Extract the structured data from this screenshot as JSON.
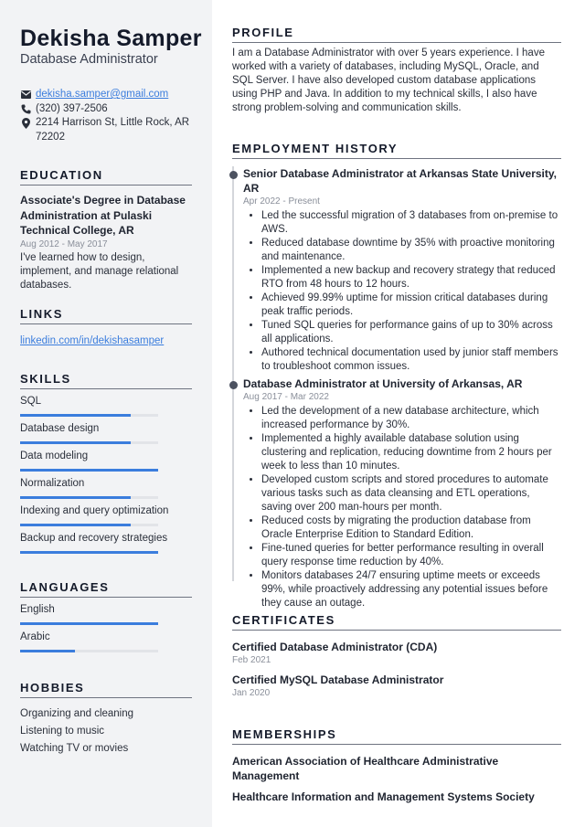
{
  "header": {
    "name": "Dekisha Samper",
    "title": "Database Administrator"
  },
  "contact": {
    "email": "dekisha.samper@gmail.com",
    "phone": "(320) 397-2506",
    "address": "2214 Harrison St, Little Rock, AR 72202",
    "icons": [
      "envelope-icon",
      "phone-icon",
      "map-pin-icon"
    ]
  },
  "education": {
    "heading": "EDUCATION",
    "degree": "Associate's Degree in Database Administration at Pulaski Technical College, AR",
    "dates": "Aug 2012 - May 2017",
    "description": "I've learned how to design, implement, and manage relational databases."
  },
  "links": {
    "heading": "LINKS",
    "items": [
      "linkedin.com/in/dekishasamper"
    ]
  },
  "skills": {
    "heading": "SKILLS",
    "items": [
      {
        "label": "SQL",
        "level": 0.8
      },
      {
        "label": "Database design",
        "level": 0.8
      },
      {
        "label": "Data modeling",
        "level": 1.0
      },
      {
        "label": "Normalization",
        "level": 0.8
      },
      {
        "label": "Indexing and query optimization",
        "level": 0.8
      },
      {
        "label": "Backup and recovery  strategies",
        "level": 1.0
      }
    ]
  },
  "languages": {
    "heading": "LANGUAGES",
    "items": [
      {
        "label": "English",
        "level": 1.0
      },
      {
        "label": "Arabic",
        "level": 0.4
      }
    ]
  },
  "hobbies": {
    "heading": "HOBBIES",
    "items": [
      "Organizing and cleaning",
      "Listening to music",
      "Watching TV or movies"
    ]
  },
  "profile": {
    "heading": "PROFILE",
    "text": "I am a Database Administrator with over 5 years experience. I have worked with a variety of databases, including MySQL, Oracle, and SQL Server. I have also developed custom database applications using PHP and Java. In addition to my technical skills, I also have strong problem-solving and communication skills."
  },
  "employment": {
    "heading": "EMPLOYMENT HISTORY",
    "jobs": [
      {
        "title": "Senior Database Administrator at Arkansas State University, AR",
        "dates": "Apr 2022 - Present",
        "bullets": [
          "Led the successful migration of 3 databases from on-premise to AWS.",
          "Reduced database downtime by 35% with proactive monitoring and maintenance.",
          "Implemented a new backup and recovery strategy that reduced RTO from 48 hours to 12 hours.",
          "Achieved 99.99% uptime for mission critical databases during peak traffic periods.",
          "Tuned SQL queries for performance gains of up to 30% across all applications.",
          "Authored technical documentation used by junior staff members to troubleshoot common issues."
        ]
      },
      {
        "title": "Database Administrator at University of Arkansas, AR",
        "dates": "Aug 2017 - Mar 2022",
        "bullets": [
          "Led the development of a new database architecture, which increased performance by 30%.",
          "Implemented a highly available database solution using clustering and replication, reducing downtime from 2 hours per week to less than 10 minutes.",
          "Developed custom scripts and stored procedures to automate various tasks such as data cleansing and ETL operations, saving over 200 man-hours per month.",
          "Reduced costs by migrating the production database from Oracle Enterprise Edition to Standard Edition.",
          "Fine-tuned queries for better performance resulting in overall query response time reduction by 40%.",
          "Monitors databases 24/7 ensuring uptime meets or exceeds 99%, while proactively addressing any potential issues before they cause an outage."
        ]
      }
    ]
  },
  "certificates": {
    "heading": "CERTIFICATES",
    "items": [
      {
        "title": "Certified Database Administrator (CDA)",
        "date": "Feb 2021"
      },
      {
        "title": "Certified MySQL Database Administrator",
        "date": "Jan 2020"
      }
    ]
  },
  "memberships": {
    "heading": "MEMBERSHIPS",
    "items": [
      "American Association of Healthcare Administrative Management",
      "Healthcare Information and Management Systems Society"
    ]
  },
  "colors": {
    "accent": "#3b7ddd",
    "sidebar_bg": "#f2f3f5",
    "heading": "#141a2a",
    "muted": "#8a8f9a"
  }
}
